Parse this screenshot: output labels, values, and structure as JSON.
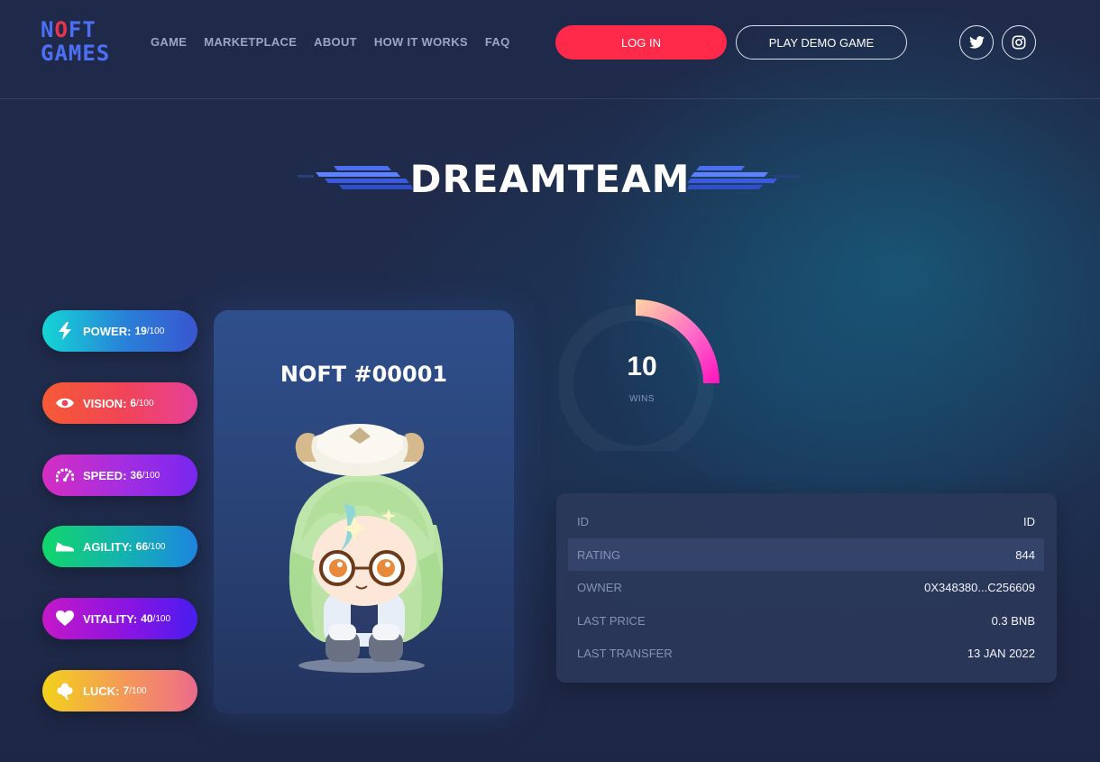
{
  "header": {
    "logo": {
      "line1_a": "N",
      "line1_o": "O",
      "line1_b": "FT",
      "line2": "GAMES"
    },
    "nav": [
      "GAME",
      "MARKETPLACE",
      "ABOUT",
      "HOW IT WORKS",
      "FAQ"
    ],
    "login_label": "LOG IN",
    "demo_label": "PLAY DEMO GAME",
    "social": [
      "twitter-icon",
      "instagram-icon"
    ]
  },
  "title": "DREAMTEAM",
  "stats": [
    {
      "label": "POWER:",
      "value": "19",
      "max": "100",
      "icon": "lightning-icon"
    },
    {
      "label": "VISION:",
      "value": "6",
      "max": "100",
      "icon": "eye-icon"
    },
    {
      "label": "SPEED:",
      "value": "36",
      "max": "100",
      "icon": "speedometer-icon"
    },
    {
      "label": "AGILITY:",
      "value": "66",
      "max": "100",
      "icon": "sneaker-icon"
    },
    {
      "label": "VITALITY:",
      "value": "40",
      "max": "100",
      "icon": "heart-icon"
    },
    {
      "label": "LUCK:",
      "value": "7",
      "max": "100",
      "icon": "clover-icon"
    }
  ],
  "card": {
    "title": "NOFT #00001"
  },
  "wins": {
    "value": "10",
    "label": "WINS"
  },
  "info": [
    {
      "key": "ID",
      "value": "ID"
    },
    {
      "key": "RATING",
      "value": "844"
    },
    {
      "key": "OWNER",
      "value": "0X348380...C256609"
    },
    {
      "key": "LAST PRICE",
      "value": "0.3 BNB"
    },
    {
      "key": "LAST TRANSFER",
      "value": "13 JAN 2022"
    }
  ],
  "colors": {
    "accent_red": "#ff2a4a",
    "logo_blue": "#4d6ff5"
  }
}
